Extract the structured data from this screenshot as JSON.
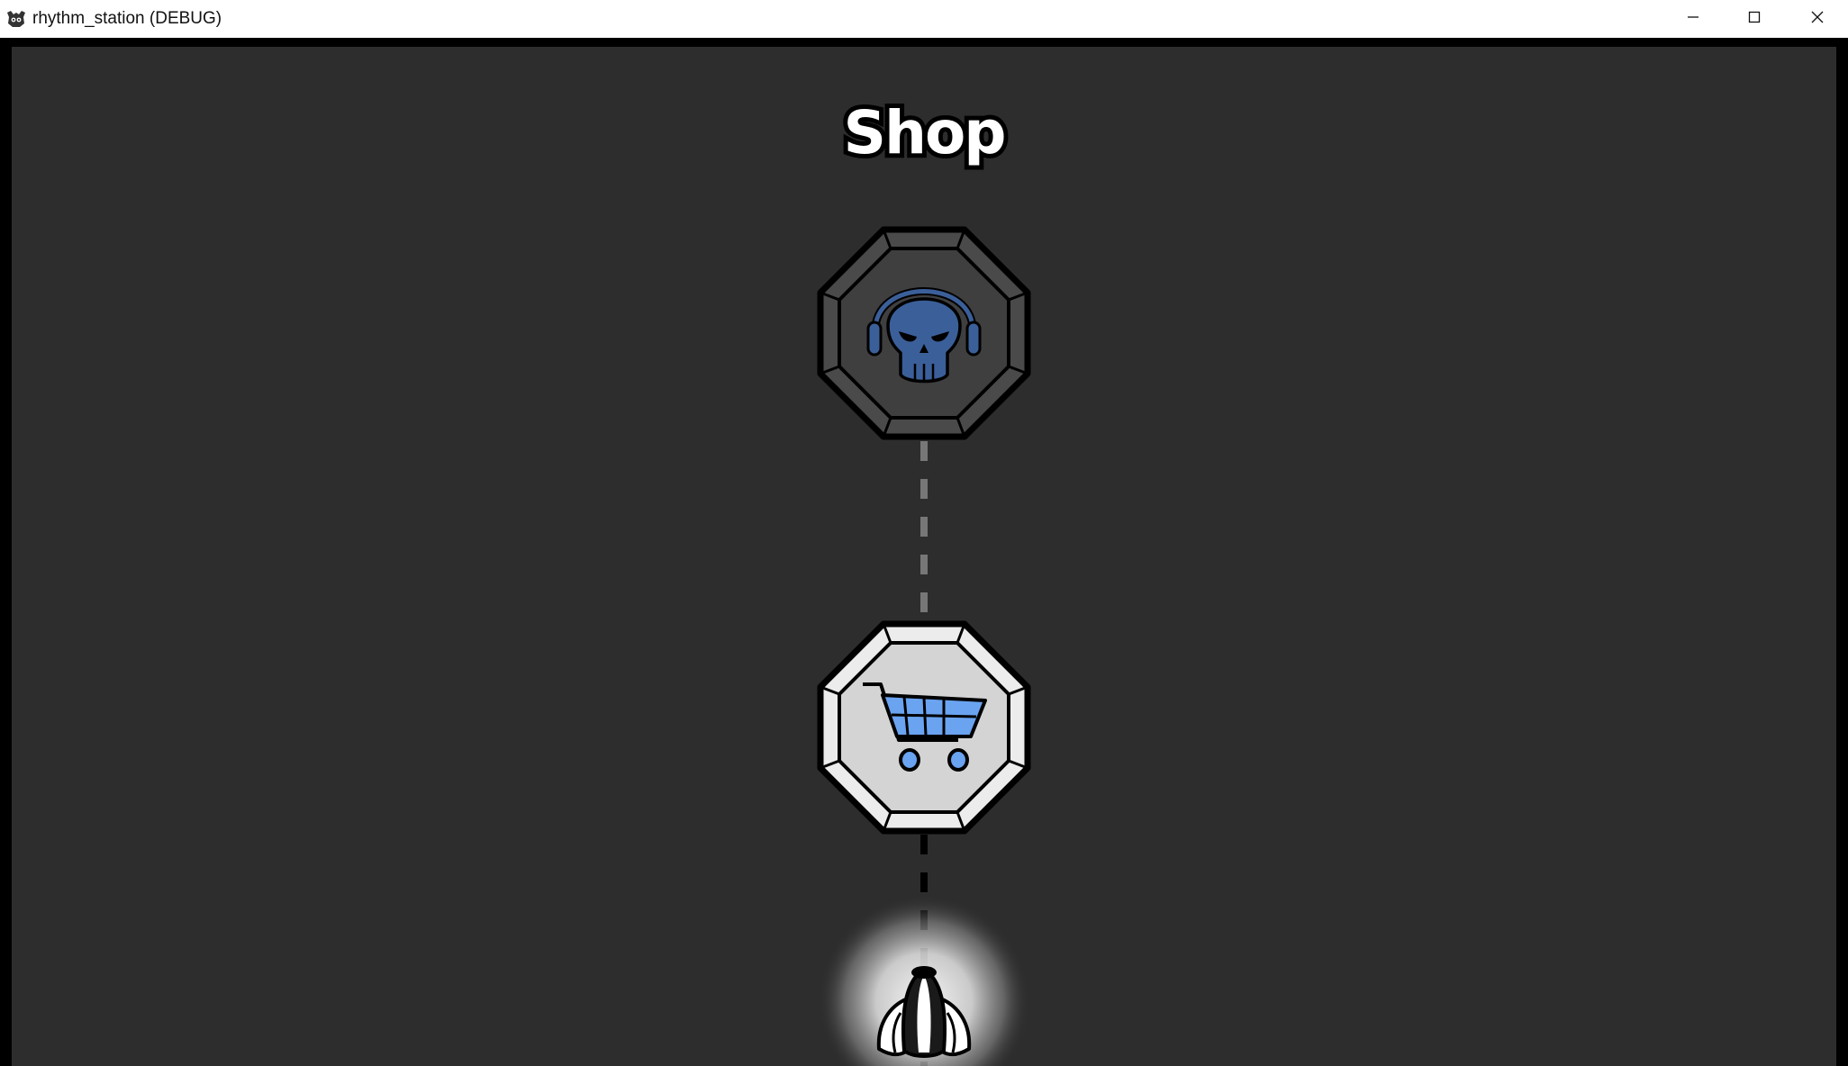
{
  "window": {
    "title": "rhythm_station (DEBUG)",
    "app_icon": "godot-icon",
    "controls": [
      "minimize-icon",
      "maximize-icon",
      "close-icon"
    ]
  },
  "screen": {
    "title": "Shop"
  },
  "nodes": [
    {
      "name": "boss-level-node",
      "icon": "skull-headphones-icon",
      "state": "locked"
    },
    {
      "name": "shop-node",
      "icon": "shopping-cart-icon",
      "state": "current"
    }
  ],
  "player": {
    "icon": "spaceship-icon"
  },
  "colors": {
    "background": "#2d2d2d",
    "locked_node_fill": "#4a4a4a",
    "current_node_fill": "#d6d6d6",
    "skull_blue": "#3b5f99",
    "cart_blue": "#6aa3f0",
    "path_locked": "#777777",
    "path_active": "#000000"
  }
}
